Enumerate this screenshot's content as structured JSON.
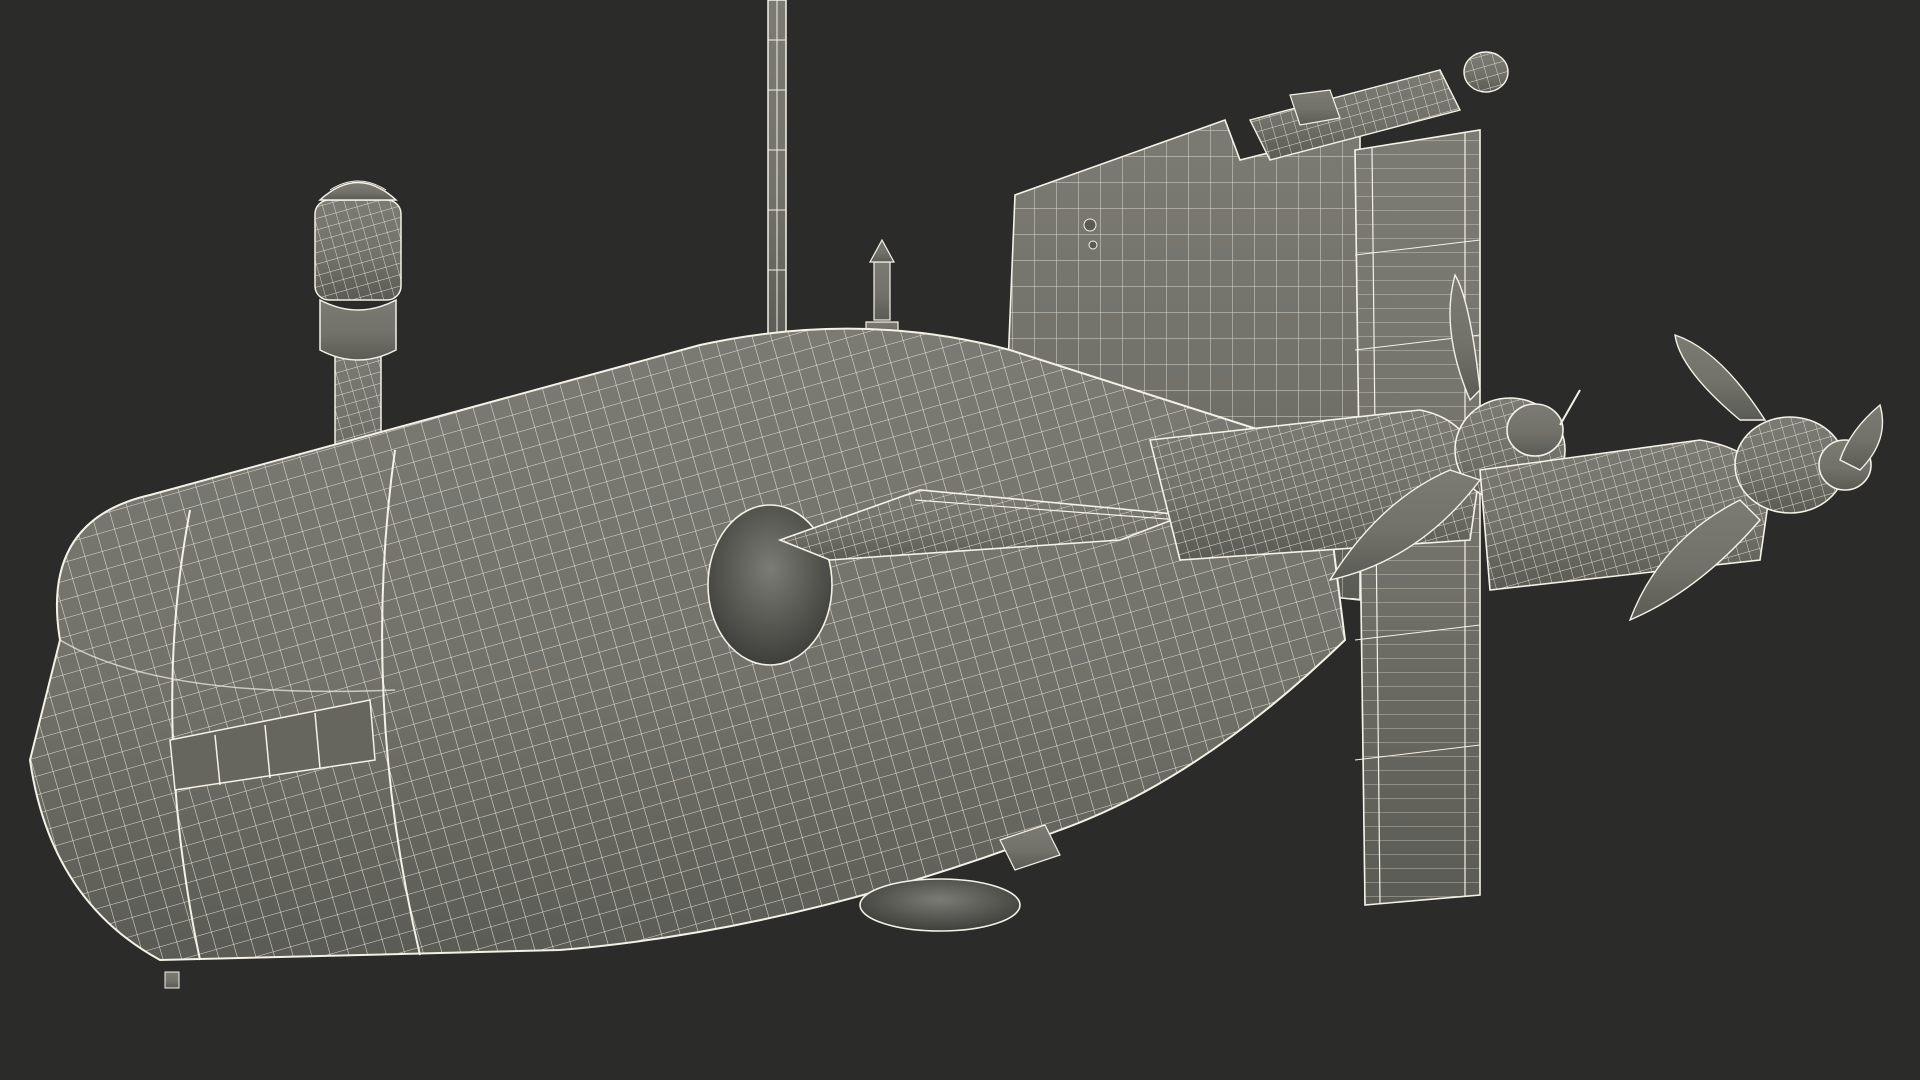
{
  "viewport": {
    "background_color": "#2b2b29"
  },
  "model": {
    "subject": "submarine",
    "render_style": "wireframe",
    "surface_color": "#72726b",
    "surface_shadow_color": "#4a4a45",
    "wire_color": "#f4f1e6"
  }
}
